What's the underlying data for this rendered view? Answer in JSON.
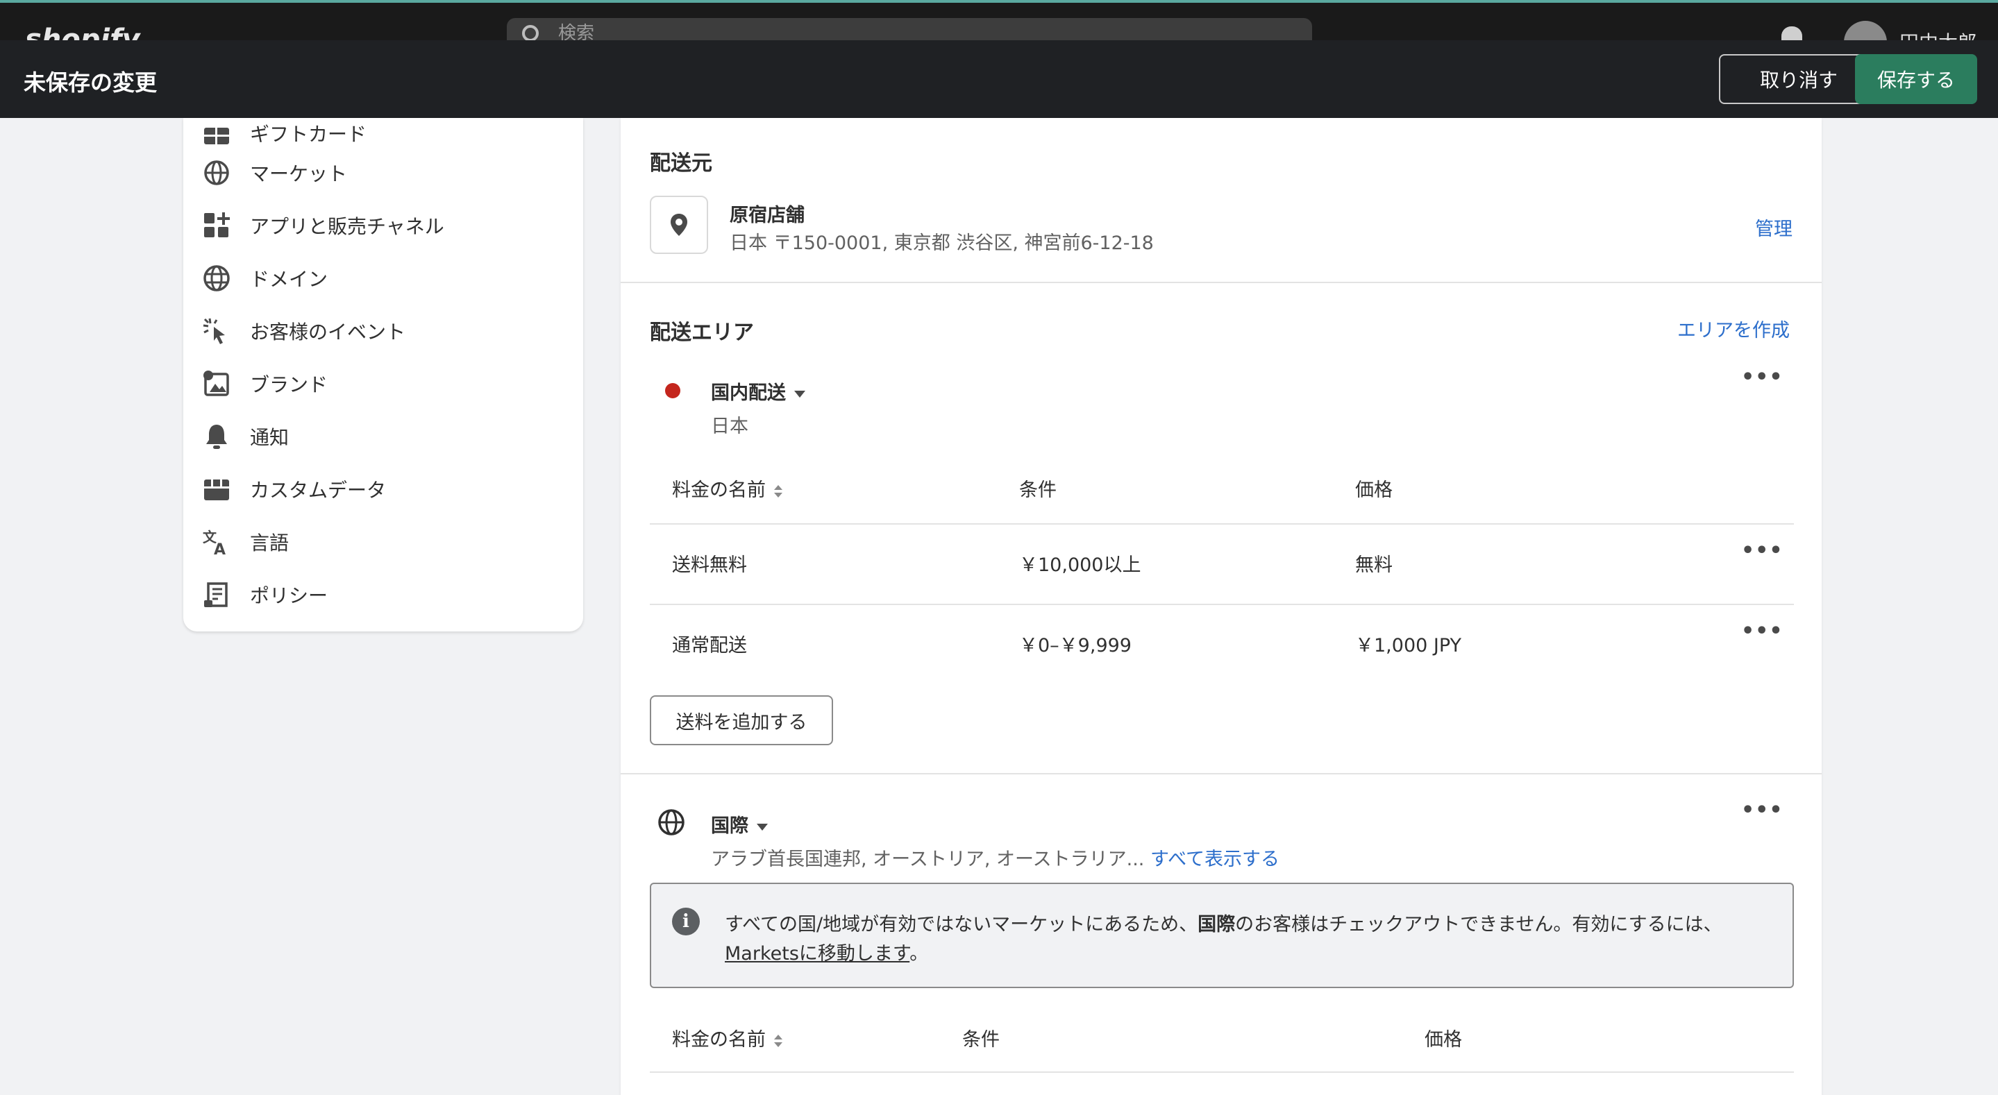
{
  "topbar": {
    "logo": "shopify",
    "search_placeholder": "検索",
    "user_name": "田中太郎"
  },
  "savebar": {
    "title": "未保存の変更",
    "discard_label": "取り消す",
    "save_label": "保存する"
  },
  "sidebar": {
    "items": [
      {
        "label": "ギフトカード",
        "icon": "gift-card-icon"
      },
      {
        "label": "マーケット",
        "icon": "globe-icon"
      },
      {
        "label": "アプリと販売チャネル",
        "icon": "apps-icon"
      },
      {
        "label": "ドメイン",
        "icon": "domain-globe-icon"
      },
      {
        "label": "お客様のイベント",
        "icon": "cursor-click-icon"
      },
      {
        "label": "ブランド",
        "icon": "brand-image-icon"
      },
      {
        "label": "通知",
        "icon": "bell-icon"
      },
      {
        "label": "カスタムデータ",
        "icon": "custom-data-icon"
      },
      {
        "label": "言語",
        "icon": "language-icon"
      },
      {
        "label": "ポリシー",
        "icon": "policy-icon"
      }
    ]
  },
  "origin": {
    "heading": "配送元",
    "location_name": "原宿店舗",
    "address": "日本 〒150-0001, 東京都 渋谷区, 神宮前6-12-18",
    "manage_link": "管理"
  },
  "zones": {
    "heading": "配送エリア",
    "create_link": "エリアを作成",
    "domestic": {
      "name": "国内配送",
      "countries": "日本",
      "columns": [
        "料金の名前",
        "条件",
        "価格"
      ],
      "rates": [
        {
          "name": "送料無料",
          "condition": "￥10,000以上",
          "price": "無料"
        },
        {
          "name": "通常配送",
          "condition": "￥0–￥9,999",
          "price": "￥1,000 JPY"
        }
      ],
      "add_rate_label": "送料を追加する"
    },
    "international": {
      "name": "国際",
      "countries": "アラブ首長国連邦, オーストリア, オーストラリア...",
      "show_all_link": "すべて表示する",
      "banner_text_1": "すべての国/地域が有効ではないマーケットにあるため、",
      "banner_bold": "国際",
      "banner_text_2": "のお客様はチェックアウトできません。有効にするには、",
      "banner_link": "Marketsに移動します",
      "banner_end": "。",
      "columns": [
        "料金の名前",
        "条件",
        "価格"
      ]
    }
  },
  "colors": {
    "save_button": "#2b7d5e",
    "link": "#2c6ecb",
    "domestic_dot": "#c4261d",
    "savebar_bg": "#1f2124"
  }
}
